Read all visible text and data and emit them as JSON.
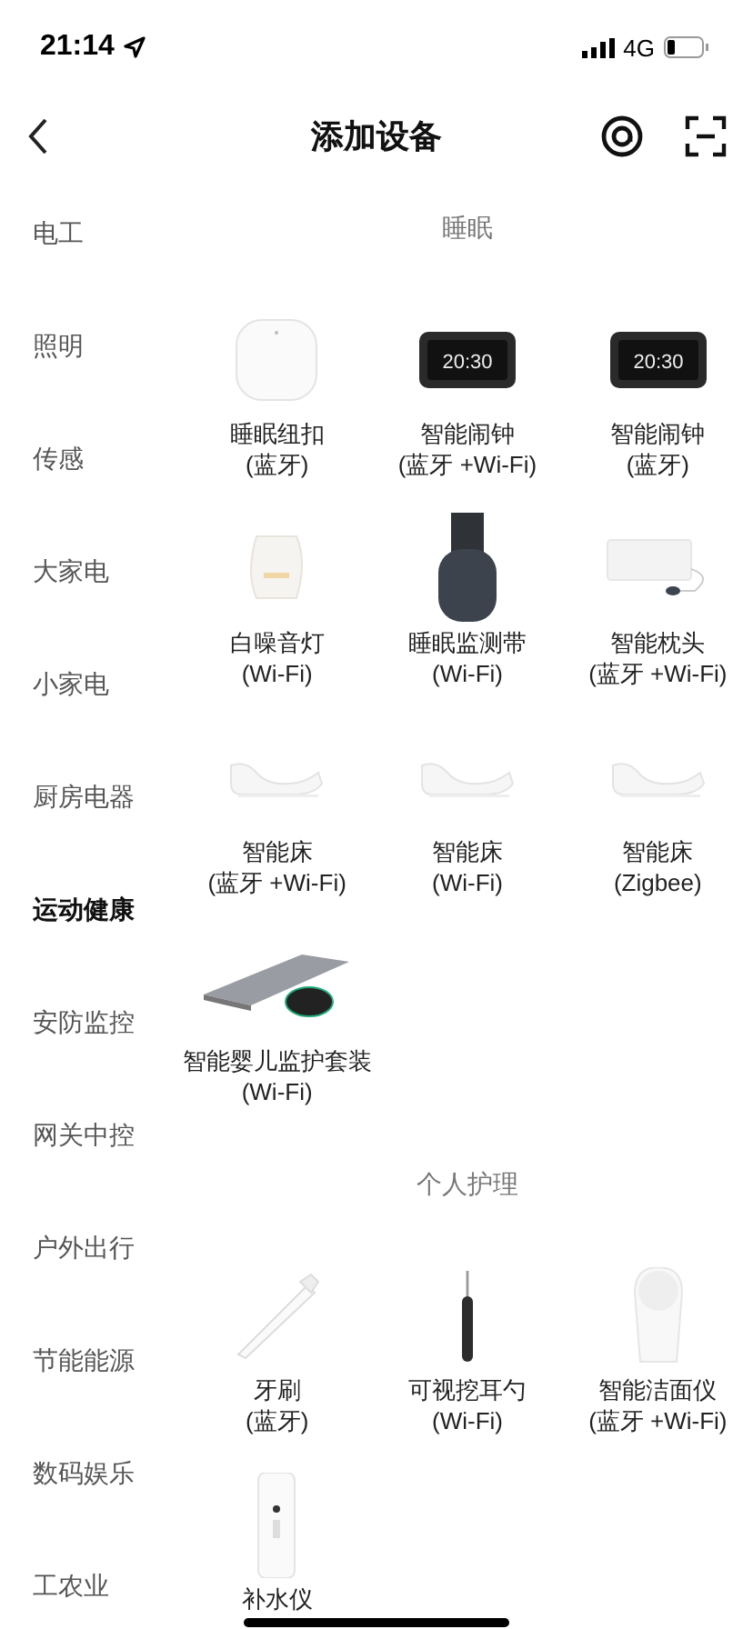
{
  "status_bar": {
    "time": "21:14",
    "network": "4G"
  },
  "header": {
    "title": "添加设备"
  },
  "sidebar": {
    "items": [
      {
        "label": "电工",
        "selected": false
      },
      {
        "label": "照明",
        "selected": false
      },
      {
        "label": "传感",
        "selected": false
      },
      {
        "label": "大家电",
        "selected": false
      },
      {
        "label": "小家电",
        "selected": false
      },
      {
        "label": "厨房电器",
        "selected": false
      },
      {
        "label": "运动健康",
        "selected": true
      },
      {
        "label": "安防监控",
        "selected": false
      },
      {
        "label": "网关中控",
        "selected": false
      },
      {
        "label": "户外出行",
        "selected": false
      },
      {
        "label": "节能能源",
        "selected": false
      },
      {
        "label": "数码娱乐",
        "selected": false
      },
      {
        "label": "工农业",
        "selected": false
      }
    ]
  },
  "sections": [
    {
      "title": "睡眠",
      "devices": [
        {
          "kind": "puck",
          "name": "睡眠纽扣",
          "connection": "(蓝牙)"
        },
        {
          "kind": "clock",
          "name": "智能闹钟",
          "connection": "(蓝牙 +Wi-Fi)",
          "screen": "20:30"
        },
        {
          "kind": "clock",
          "name": "智能闹钟",
          "connection": "(蓝牙)",
          "screen": "20:30"
        },
        {
          "kind": "lamp",
          "name": "白噪音灯",
          "connection": "(Wi-Fi)"
        },
        {
          "kind": "band",
          "name": "睡眠监测带",
          "connection": "(Wi-Fi)"
        },
        {
          "kind": "pillow",
          "name": "智能枕头",
          "connection": "(蓝牙 +Wi-Fi)"
        },
        {
          "kind": "bed",
          "name": "智能床",
          "connection": "(蓝牙 +Wi-Fi)"
        },
        {
          "kind": "bed",
          "name": "智能床",
          "connection": "(Wi-Fi)"
        },
        {
          "kind": "bed",
          "name": "智能床",
          "connection": "(Zigbee)"
        },
        {
          "kind": "mat",
          "name": "智能婴儿监护套装",
          "connection": "(Wi-Fi)"
        }
      ]
    },
    {
      "title": "个人护理",
      "devices": [
        {
          "kind": "toothbrush",
          "name": "牙刷",
          "connection": "(蓝牙)"
        },
        {
          "kind": "earpick",
          "name": "可视挖耳勺",
          "connection": "(Wi-Fi)"
        },
        {
          "kind": "cleanser",
          "name": "智能洁面仪",
          "connection": "(蓝牙 +Wi-Fi)"
        },
        {
          "kind": "sprayer",
          "name": "补水仪"
        }
      ]
    }
  ]
}
